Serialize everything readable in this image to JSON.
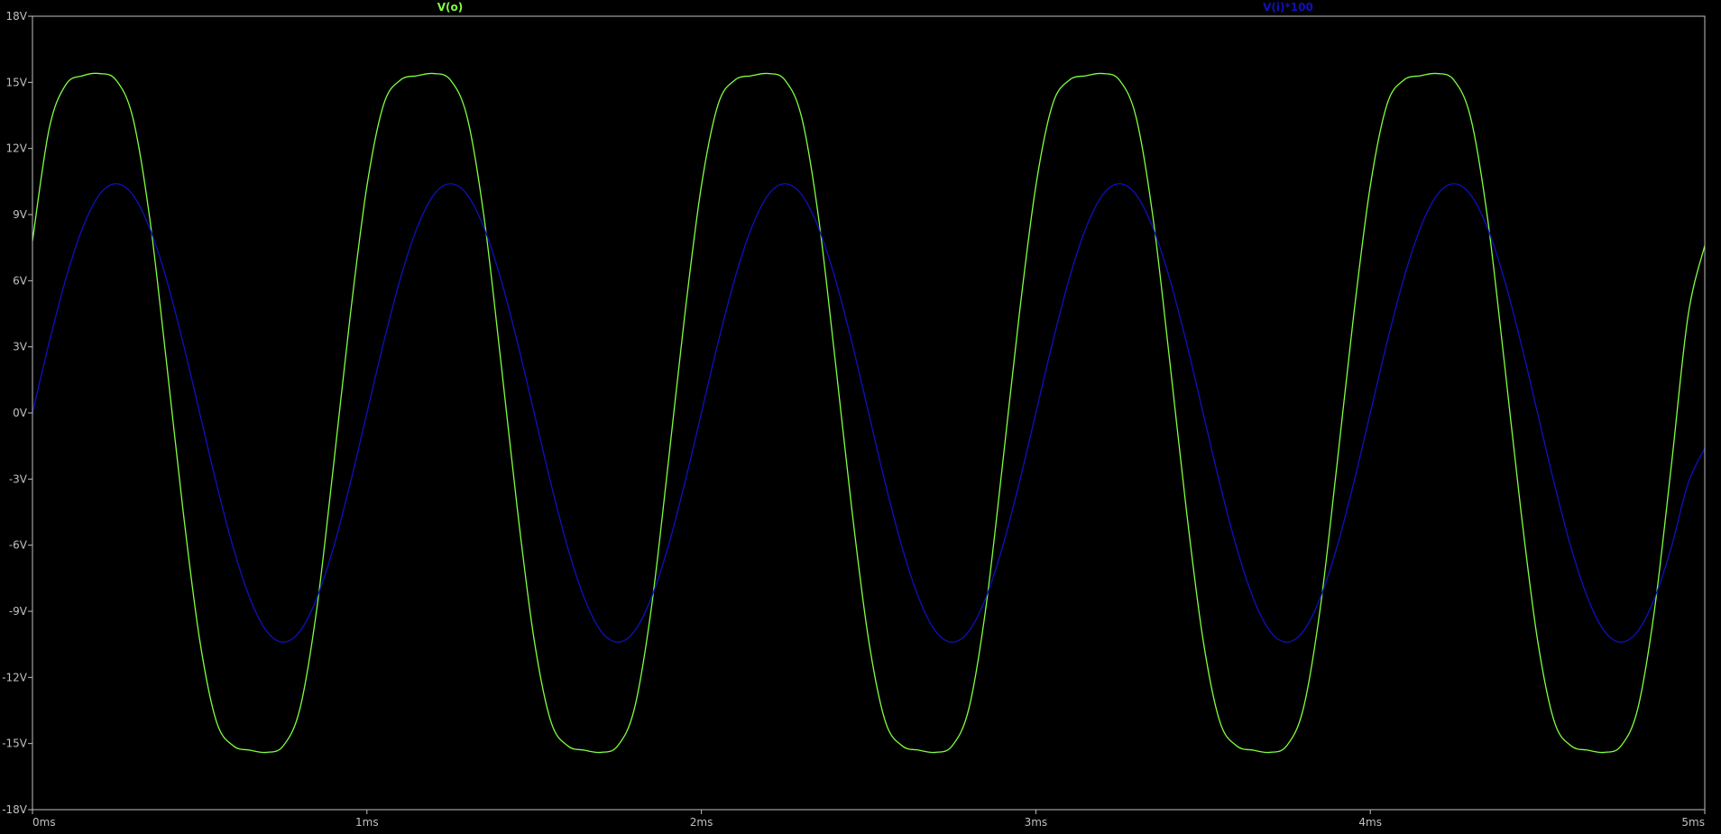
{
  "chart_data": {
    "type": "line",
    "xlim": [
      0,
      5
    ],
    "ylim": [
      -18,
      18
    ],
    "x_ticks": [
      {
        "value": 0,
        "label": "0ms"
      },
      {
        "value": 1,
        "label": "1ms"
      },
      {
        "value": 2,
        "label": "2ms"
      },
      {
        "value": 3,
        "label": "3ms"
      },
      {
        "value": 4,
        "label": "4ms"
      },
      {
        "value": 5,
        "label": "5ms"
      }
    ],
    "y_ticks": [
      {
        "value": 18,
        "label": "18V"
      },
      {
        "value": 15,
        "label": "15V"
      },
      {
        "value": 12,
        "label": "12V"
      },
      {
        "value": 9,
        "label": "9V"
      },
      {
        "value": 6,
        "label": "6V"
      },
      {
        "value": 3,
        "label": "3V"
      },
      {
        "value": 0,
        "label": "0V"
      },
      {
        "value": -3,
        "label": "-3V"
      },
      {
        "value": -6,
        "label": "-6V"
      },
      {
        "value": -9,
        "label": "-9V"
      },
      {
        "value": -12,
        "label": "-12V"
      },
      {
        "value": -15,
        "label": "-15V"
      },
      {
        "value": -18,
        "label": "-18V"
      }
    ],
    "grid": false,
    "colors": {
      "background": "#000000",
      "axis": "#c0c0c0",
      "v_o": "#80ff40",
      "v_i": "#1010c0"
    },
    "series": [
      {
        "name": "V(o)",
        "color": "#80ff40",
        "x": [
          0,
          0.05,
          0.1,
          0.15,
          0.2,
          0.25,
          0.3,
          0.35,
          0.4,
          0.45,
          0.5,
          0.55,
          0.6,
          0.65,
          0.7,
          0.75,
          0.8,
          0.85,
          0.9,
          0.95,
          1.0,
          1.05,
          1.1,
          1.15,
          1.2,
          1.25,
          1.3,
          1.35,
          1.4,
          1.45,
          1.5,
          1.55,
          1.6,
          1.65,
          1.7,
          1.75,
          1.8,
          1.85,
          1.9,
          1.95,
          2.0,
          2.05,
          2.1,
          2.15,
          2.2,
          2.25,
          2.3,
          2.35,
          2.4,
          2.45,
          2.5,
          2.55,
          2.6,
          2.65,
          2.7,
          2.75,
          2.8,
          2.85,
          2.9,
          2.95,
          3.0,
          3.05,
          3.1,
          3.15,
          3.2,
          3.25,
          3.3,
          3.35,
          3.4,
          3.45,
          3.5,
          3.55,
          3.6,
          3.65,
          3.7,
          3.75,
          3.8,
          3.85,
          3.9,
          3.95,
          4.0,
          4.05,
          4.1,
          4.15,
          4.2,
          4.25,
          4.3,
          4.35,
          4.4,
          4.45,
          4.5,
          4.55,
          4.6,
          4.65,
          4.7,
          4.75,
          4.8,
          4.85,
          4.9,
          4.95,
          5.0
        ],
        "y": [
          7.8,
          12.9,
          14.9,
          15.3,
          15.4,
          15.1,
          13.4,
          8.9,
          2.4,
          -4.4,
          -10.3,
          -14.0,
          -15.1,
          -15.3,
          -15.4,
          -15.1,
          -13.4,
          -8.9,
          -2.4,
          4.4,
          10.3,
          14.0,
          15.1,
          15.3,
          15.4,
          15.1,
          13.4,
          8.9,
          2.4,
          -4.4,
          -10.3,
          -14.0,
          -15.1,
          -15.3,
          -15.4,
          -15.1,
          -13.4,
          -8.9,
          -2.4,
          4.4,
          10.3,
          14.0,
          15.1,
          15.3,
          15.4,
          15.1,
          13.4,
          8.9,
          2.4,
          -4.4,
          -10.3,
          -14.0,
          -15.1,
          -15.3,
          -15.4,
          -15.1,
          -13.4,
          -8.9,
          -2.4,
          4.4,
          10.3,
          14.0,
          15.1,
          15.3,
          15.4,
          15.1,
          13.4,
          8.9,
          2.4,
          -4.4,
          -10.3,
          -14.0,
          -15.1,
          -15.3,
          -15.4,
          -15.1,
          -13.4,
          -8.9,
          -2.4,
          4.4,
          10.3,
          14.0,
          15.1,
          15.3,
          15.4,
          15.1,
          13.4,
          8.9,
          2.4,
          -4.4,
          -10.3,
          -14.0,
          -15.1,
          -15.3,
          -15.4,
          -15.1,
          -13.4,
          -8.9,
          -2.4,
          4.4,
          7.6
        ]
      },
      {
        "name": "V(i)*100",
        "color": "#1010c0",
        "x": [
          0,
          0.05,
          0.1,
          0.15,
          0.2,
          0.25,
          0.3,
          0.35,
          0.4,
          0.45,
          0.5,
          0.55,
          0.6,
          0.65,
          0.7,
          0.75,
          0.8,
          0.85,
          0.9,
          0.95,
          1.0,
          1.05,
          1.1,
          1.15,
          1.2,
          1.25,
          1.3,
          1.35,
          1.4,
          1.45,
          1.5,
          1.55,
          1.6,
          1.65,
          1.7,
          1.75,
          1.8,
          1.85,
          1.9,
          1.95,
          2.0,
          2.05,
          2.1,
          2.15,
          2.2,
          2.25,
          2.3,
          2.35,
          2.4,
          2.45,
          2.5,
          2.55,
          2.6,
          2.65,
          2.7,
          2.75,
          2.8,
          2.85,
          2.9,
          2.95,
          3.0,
          3.05,
          3.1,
          3.15,
          3.2,
          3.25,
          3.3,
          3.35,
          3.4,
          3.45,
          3.5,
          3.55,
          3.6,
          3.65,
          3.7,
          3.75,
          3.8,
          3.85,
          3.9,
          3.95,
          4.0,
          4.05,
          4.1,
          4.15,
          4.2,
          4.25,
          4.3,
          4.35,
          4.4,
          4.45,
          4.5,
          4.55,
          4.6,
          4.65,
          4.7,
          4.75,
          4.8,
          4.85,
          4.9,
          4.95,
          5.0
        ],
        "y": [
          0.0,
          3.2,
          6.1,
          8.4,
          9.9,
          10.4,
          9.9,
          8.4,
          6.1,
          3.2,
          0.0,
          -3.2,
          -6.1,
          -8.4,
          -9.9,
          -10.4,
          -9.9,
          -8.4,
          -6.1,
          -3.2,
          0.0,
          3.2,
          6.1,
          8.4,
          9.9,
          10.4,
          9.9,
          8.4,
          6.1,
          3.2,
          0.0,
          -3.2,
          -6.1,
          -8.4,
          -9.9,
          -10.4,
          -9.9,
          -8.4,
          -6.1,
          -3.2,
          0.0,
          3.2,
          6.1,
          8.4,
          9.9,
          10.4,
          9.9,
          8.4,
          6.1,
          3.2,
          0.0,
          -3.2,
          -6.1,
          -8.4,
          -9.9,
          -10.4,
          -9.9,
          -8.4,
          -6.1,
          -3.2,
          0.0,
          3.2,
          6.1,
          8.4,
          9.9,
          10.4,
          9.9,
          8.4,
          6.1,
          3.2,
          0.0,
          -3.2,
          -6.1,
          -8.4,
          -9.9,
          -10.4,
          -9.9,
          -8.4,
          -6.1,
          -3.2,
          0.0,
          3.2,
          6.1,
          8.4,
          9.9,
          10.4,
          9.9,
          8.4,
          6.1,
          3.2,
          0.0,
          -3.2,
          -6.1,
          -8.4,
          -9.9,
          -10.4,
          -9.9,
          -8.4,
          -6.1,
          -3.2,
          -1.6
        ]
      }
    ]
  }
}
